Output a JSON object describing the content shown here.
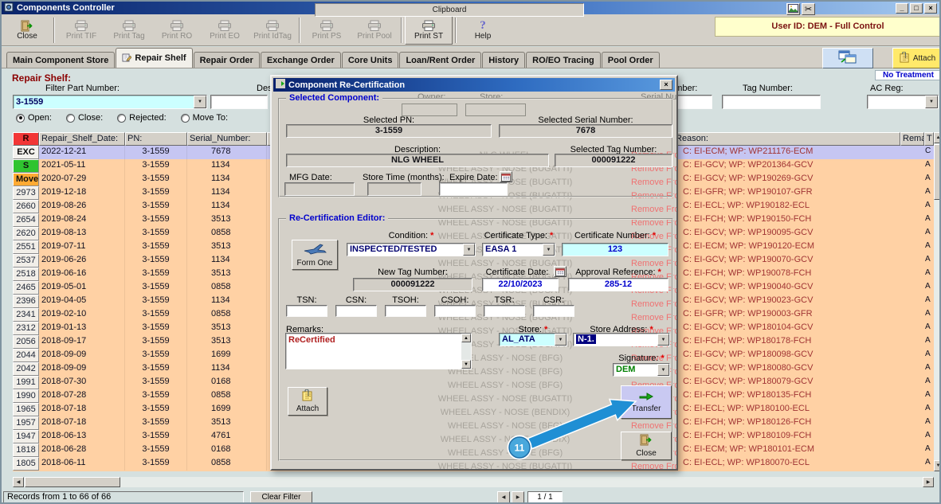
{
  "window": {
    "title": "Components Controller",
    "controls": {
      "min": "_",
      "max": "□",
      "close": "×"
    }
  },
  "icons_text": {
    "up": "▲",
    "down": "▼",
    "left": "◀",
    "right": "▶"
  },
  "toolbar": {
    "clipboard_label": "Clipboard",
    "user_bar": "User ID: DEM - Full Control",
    "groups": [
      [
        {
          "label": "Close",
          "icon": "exit-door-icon",
          "enabled": true,
          "emphasized": false
        }
      ],
      [
        {
          "label": "Print TIF",
          "icon": "printer-icon",
          "enabled": false,
          "emphasized": false
        },
        {
          "label": "Print Tag",
          "icon": "printer-icon",
          "enabled": false,
          "emphasized": false
        },
        {
          "label": "Print RO",
          "icon": "printer-icon",
          "enabled": false,
          "emphasized": false
        },
        {
          "label": "Print EO",
          "icon": "printer-icon",
          "enabled": false,
          "emphasized": false
        },
        {
          "label": "Print IdTag",
          "icon": "printer-icon",
          "enabled": false,
          "emphasized": false
        }
      ],
      [
        {
          "label": "Print PS",
          "icon": "printer-icon",
          "enabled": false,
          "emphasized": false
        },
        {
          "label": "Print Pool",
          "icon": "printer-icon",
          "enabled": false,
          "emphasized": false
        }
      ],
      [
        {
          "label": "Print ST",
          "icon": "printer-icon",
          "enabled": true,
          "emphasized": true
        }
      ],
      [
        {
          "label": "Help",
          "icon": "help-icon",
          "enabled": true,
          "emphasized": false
        }
      ]
    ]
  },
  "tabs": [
    {
      "label": "Main Component Store",
      "active": false
    },
    {
      "label": "Repair Shelf",
      "active": true
    },
    {
      "label": "Repair Order",
      "active": false
    },
    {
      "label": "Exchange Order",
      "active": false
    },
    {
      "label": "Core Units",
      "active": false
    },
    {
      "label": "Loan/Rent Order",
      "active": false
    },
    {
      "label": "History",
      "active": false
    },
    {
      "label": "RO/EO Tracing",
      "active": false
    },
    {
      "label": "Pool Order",
      "active": false
    }
  ],
  "quick_actions": {
    "attach_label": "Attach",
    "no_treatment": "No Treatment"
  },
  "filters": {
    "section_title": "Repair Shelf:",
    "part_number_label": "Filter Part Number:",
    "part_number_value": "3-1559",
    "description_label": "Description:",
    "description_value": "",
    "owner_label": "Owner:",
    "store_label": "Store:",
    "serial_number_label": "Serial Number:",
    "serial_number_value": "",
    "tag_number_label": "Tag Number:",
    "tag_number_value": "",
    "ac_reg_label": "AC Reg:",
    "ac_reg_value": "",
    "radios": [
      {
        "label": "Open:",
        "checked": true
      },
      {
        "label": "Close:",
        "checked": false
      },
      {
        "label": "Rejected:",
        "checked": false
      },
      {
        "label": "Move To:",
        "checked": false
      }
    ]
  },
  "table": {
    "remove_from_label": "Remove From",
    "headers": {
      "badge": "R",
      "date": "Repair_Shelf_Date:",
      "pn": "PN:",
      "serial": "Serial_Number:",
      "reason": "Reason:",
      "remarks": "Remarks:",
      "t": "T"
    },
    "rows": [
      {
        "badge": "EXC",
        "badge_type": "exc",
        "date": "2022-12-21",
        "pn": "3-1559",
        "serial": "7678",
        "description": "NLG WHEEL",
        "reason": "C: EI-ECM; WP: WP211176-ECM",
        "t": "C",
        "selected": true
      },
      {
        "badge": "S",
        "badge_type": "s",
        "date": "2021-05-11",
        "pn": "3-1559",
        "serial": "1134",
        "description": "WHEEL ASSY - NOSE (BUGATTI)",
        "reason": "C: EI-GCV; WP: WP201364-GCV",
        "t": "A",
        "selected": false
      },
      {
        "badge": "Move",
        "badge_type": "move",
        "date": "2020-07-29",
        "pn": "3-1559",
        "serial": "1134",
        "description": "WHEEL ASSY - NOSE (BUGATTI)",
        "reason": "C: EI-GCV; WP: WP190269-GCV",
        "t": "A",
        "selected": false
      },
      {
        "badge": "2973",
        "badge_type": "num",
        "date": "2019-12-18",
        "pn": "3-1559",
        "serial": "1134",
        "description": "WHEEL ASSY - NOSE (BUGATTI)",
        "reason": "C: EI-GFR; WP: WP190107-GFR",
        "t": "A",
        "selected": false
      },
      {
        "badge": "2660",
        "badge_type": "num",
        "date": "2019-08-26",
        "pn": "3-1559",
        "serial": "1134",
        "description": "WHEEL ASSY - NOSE (BUGATTI)",
        "reason": "C: EI-ECL; WP: WP190182-ECL",
        "t": "A",
        "selected": false
      },
      {
        "badge": "2654",
        "badge_type": "num",
        "date": "2019-08-24",
        "pn": "3-1559",
        "serial": "3513",
        "description": "WHEEL ASSY - NOSE (BUGATTI)",
        "reason": "C: EI-FCH; WP: WP190150-FCH",
        "t": "A",
        "selected": false
      },
      {
        "badge": "2620",
        "badge_type": "num",
        "date": "2019-08-13",
        "pn": "3-1559",
        "serial": "0858",
        "description": "WHEEL ASSY - NOSE (BUGATTI)",
        "reason": "C: EI-GCV; WP: WP190095-GCV",
        "t": "A",
        "selected": false
      },
      {
        "badge": "2551",
        "badge_type": "num",
        "date": "2019-07-11",
        "pn": "3-1559",
        "serial": "3513",
        "description": "WHEEL ASSY - NOSE (BUGATTI)",
        "reason": "C: EI-ECM; WP: WP190120-ECM",
        "t": "A",
        "selected": false
      },
      {
        "badge": "2537",
        "badge_type": "num",
        "date": "2019-06-26",
        "pn": "3-1559",
        "serial": "1134",
        "description": "WHEEL ASSY - NOSE (BUGATTI)",
        "reason": "C: EI-GCV; WP: WP190070-GCV",
        "t": "A",
        "selected": false
      },
      {
        "badge": "2518",
        "badge_type": "num",
        "date": "2019-06-16",
        "pn": "3-1559",
        "serial": "3513",
        "description": "WHEEL ASSY - NOSE (BUGATTI)",
        "reason": "C: EI-FCH; WP: WP190078-FCH",
        "t": "A",
        "selected": false
      },
      {
        "badge": "2465",
        "badge_type": "num",
        "date": "2019-05-01",
        "pn": "3-1559",
        "serial": "0858",
        "description": "WHEEL ASSY - NOSE (BUGATTI)",
        "reason": "C: EI-GCV; WP: WP190040-GCV",
        "t": "A",
        "selected": false
      },
      {
        "badge": "2396",
        "badge_type": "num",
        "date": "2019-04-05",
        "pn": "3-1559",
        "serial": "1134",
        "description": "WHEEL ASSY - NOSE (BUGATTI)",
        "reason": "C: EI-GCV; WP: WP190023-GCV",
        "t": "A",
        "selected": false
      },
      {
        "badge": "2341",
        "badge_type": "num",
        "date": "2019-02-10",
        "pn": "3-1559",
        "serial": "0858",
        "description": "WHEEL ASSY - NOSE (BUGATTI)",
        "reason": "C: EI-GFR; WP: WP190003-GFR",
        "t": "A",
        "selected": false
      },
      {
        "badge": "2312",
        "badge_type": "num",
        "date": "2019-01-13",
        "pn": "3-1559",
        "serial": "3513",
        "description": "WHEEL ASSY - NOSE (BUGATTI)",
        "reason": "C: EI-GCV; WP: WP180104-GCV",
        "t": "A",
        "selected": false
      },
      {
        "badge": "2056",
        "badge_type": "num",
        "date": "2018-09-17",
        "pn": "3-1559",
        "serial": "3513",
        "description": "WHEEL ASSY - NOSE (BUGATTI)",
        "reason": "C: EI-FCH; WP: WP180178-FCH",
        "t": "A",
        "selected": false
      },
      {
        "badge": "2044",
        "badge_type": "num",
        "date": "2018-09-09",
        "pn": "3-1559",
        "serial": "1699",
        "description": "WHEEL ASSY - NOSE (BFG)",
        "reason": "C: EI-GCV; WP: WP180098-GCV",
        "t": "A",
        "selected": false
      },
      {
        "badge": "2042",
        "badge_type": "num",
        "date": "2018-09-09",
        "pn": "3-1559",
        "serial": "1134",
        "description": "WHEEL ASSY - NOSE (BFG)",
        "reason": "C: EI-GCV; WP: WP180080-GCV",
        "t": "A",
        "selected": false
      },
      {
        "badge": "1991",
        "badge_type": "num",
        "date": "2018-07-30",
        "pn": "3-1559",
        "serial": "0168",
        "description": "WHEEL ASSY - NOSE (BFG)",
        "reason": "C: EI-GCV; WP: WP180079-GCV",
        "t": "A",
        "selected": false
      },
      {
        "badge": "1990",
        "badge_type": "num",
        "date": "2018-07-28",
        "pn": "3-1559",
        "serial": "0858",
        "description": "WHEEL ASSY - NOSE (BUGATTI)",
        "reason": "C: EI-FCH; WP: WP180135-FCH",
        "t": "A",
        "selected": false
      },
      {
        "badge": "1965",
        "badge_type": "num",
        "date": "2018-07-18",
        "pn": "3-1559",
        "serial": "1699",
        "description": "WHEEL ASSY - NOSE (BENDIX)",
        "reason": "C: EI-ECL; WP: WP180100-ECL",
        "t": "A",
        "selected": false
      },
      {
        "badge": "1957",
        "badge_type": "num",
        "date": "2018-07-18",
        "pn": "3-1559",
        "serial": "3513",
        "description": "WHEEL ASSY - NOSE (BFG)",
        "reason": "C: EI-FCH; WP: WP180126-FCH",
        "t": "A",
        "selected": false
      },
      {
        "badge": "1947",
        "badge_type": "num",
        "date": "2018-06-13",
        "pn": "3-1559",
        "serial": "4761",
        "description": "WHEEL ASSY - NOSE (BENDIX)",
        "reason": "C: EI-FCH; WP: WP180109-FCH",
        "t": "A",
        "selected": false
      },
      {
        "badge": "1818",
        "badge_type": "num",
        "date": "2018-06-28",
        "pn": "3-1559",
        "serial": "0168",
        "description": "WHEEL ASSY - NOSE (BFG)",
        "reason": "C: EI-ECM; WP: WP180101-ECM",
        "t": "A",
        "selected": false
      },
      {
        "badge": "1805",
        "badge_type": "num",
        "date": "2018-06-11",
        "pn": "3-1559",
        "serial": "0858",
        "description": "WHEEL ASSY - NOSE (BUGATTI)",
        "reason": "C: EI-ECL; WP: WP180070-ECL",
        "t": "A",
        "selected": false
      }
    ]
  },
  "status_bar": {
    "records": "Records from 1 to 66 of 66",
    "clear_filter_label": "Clear Filter",
    "page_indicator": "1 / 1"
  },
  "dialog": {
    "title": "Component Re-Certification",
    "req_mark": "*",
    "selected_component": {
      "group_label": "Selected Component:",
      "selected_pn_label": "Selected PN:",
      "selected_pn": "3-1559",
      "selected_serial_label": "Selected Serial Number:",
      "selected_serial": "7678",
      "description_label": "Description:",
      "description": "NLG WHEEL",
      "selected_tag_label": "Selected Tag Number:",
      "selected_tag": "000091222",
      "mfg_date_label": "MFG Date:",
      "mfg_date": "",
      "store_time_label": "Store Time (months):",
      "store_time": "",
      "expire_date_label": "Expire Date:",
      "expire_date": ""
    },
    "editor": {
      "group_label": "Re-Certification Editor:",
      "condition_label": "Condition:",
      "condition_value": "INSPECTED/TESTED",
      "certificate_type_label": "Certificate Type:",
      "certificate_type_value": "EASA 1",
      "certificate_number_label": "Certificate Number:",
      "certificate_number_value": "123",
      "form_one_label": "Form One",
      "new_tag_label": "New Tag Number:",
      "new_tag_value": "000091222",
      "certificate_date_label": "Certificate Date:",
      "certificate_date_value": "22/10/2023",
      "approval_reference_label": "Approval Reference:",
      "approval_reference_value": "285-12",
      "tsn_label": "TSN:",
      "csn_label": "CSN:",
      "tsoh_label": "TSOH:",
      "csoh_label": "CSOH:",
      "tsr_label": "TSR:",
      "csr_label": "CSR:",
      "tsn_value": "",
      "csn_value": "",
      "tsoh_value": "",
      "csoh_value": "",
      "tsr_value": "",
      "csr_value": "",
      "remarks_label": "Remarks:",
      "remarks_value": "ReCertified",
      "store_label": "Store:",
      "store_value": "AL_ATA",
      "store_address_label": "Store Address:",
      "store_address_value": "N-1.",
      "signature_label": "Signature:",
      "signature_value": "DEM",
      "attach_label": "Attach",
      "transfer_label": "Transfer",
      "close_label": "Close"
    }
  },
  "callout": {
    "number": "11"
  },
  "colors": {
    "row_orange": "#ffd1a4",
    "selected_row": "#c6c6f2",
    "user_bar_bg": "#ffffcc",
    "field_cyan": "#ccffff",
    "mandatory_red": "#e00000",
    "reason_text": "#a03434"
  }
}
